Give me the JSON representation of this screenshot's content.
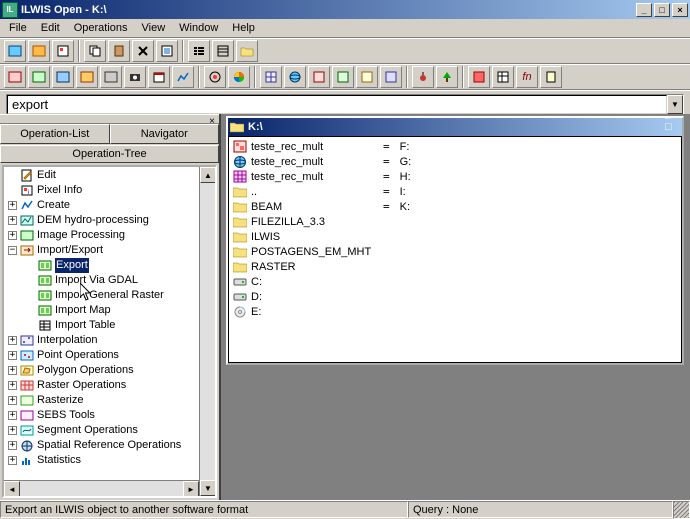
{
  "window": {
    "title": "ILWIS Open - K:\\"
  },
  "menu": [
    "File",
    "Edit",
    "Operations",
    "View",
    "Window",
    "Help"
  ],
  "command": {
    "value": "export"
  },
  "left_pane": {
    "tabs": [
      "Operation-List",
      "Navigator"
    ],
    "subtitle": "Operation-Tree",
    "tree": [
      {
        "lvl": 1,
        "exp": null,
        "icon": "edit-icon",
        "label": "Edit"
      },
      {
        "lvl": 1,
        "exp": null,
        "icon": "pixel-icon",
        "label": "Pixel Info"
      },
      {
        "lvl": 1,
        "exp": "+",
        "icon": "create-icon",
        "label": "Create"
      },
      {
        "lvl": 1,
        "exp": "+",
        "icon": "dem-icon",
        "label": "DEM hydro-processing"
      },
      {
        "lvl": 1,
        "exp": "+",
        "icon": "image-icon",
        "label": "Image Processing"
      },
      {
        "lvl": 1,
        "exp": "-",
        "icon": "importexport-icon",
        "label": "Import/Export"
      },
      {
        "lvl": 2,
        "exp": null,
        "icon": "op-icon",
        "label": "Export",
        "selected": true
      },
      {
        "lvl": 2,
        "exp": null,
        "icon": "op-icon",
        "label": "Import Via GDAL"
      },
      {
        "lvl": 2,
        "exp": null,
        "icon": "op-icon",
        "label": "Import General Raster"
      },
      {
        "lvl": 2,
        "exp": null,
        "icon": "op-icon",
        "label": "Import Map"
      },
      {
        "lvl": 2,
        "exp": null,
        "icon": "table-icon",
        "label": "Import Table"
      },
      {
        "lvl": 1,
        "exp": "+",
        "icon": "interp-icon",
        "label": "Interpolation"
      },
      {
        "lvl": 1,
        "exp": "+",
        "icon": "point-icon",
        "label": "Point Operations"
      },
      {
        "lvl": 1,
        "exp": "+",
        "icon": "poly-icon",
        "label": "Polygon Operations"
      },
      {
        "lvl": 1,
        "exp": "+",
        "icon": "raster-icon",
        "label": "Raster Operations"
      },
      {
        "lvl": 1,
        "exp": "+",
        "icon": "rasterize-icon",
        "label": "Rasterize"
      },
      {
        "lvl": 1,
        "exp": "+",
        "icon": "sebs-icon",
        "label": "SEBS Tools"
      },
      {
        "lvl": 1,
        "exp": "+",
        "icon": "segment-icon",
        "label": "Segment Operations"
      },
      {
        "lvl": 1,
        "exp": "+",
        "icon": "srs-icon",
        "label": "Spatial Reference Operations"
      },
      {
        "lvl": 1,
        "exp": "+",
        "icon": "stats-icon",
        "label": "Statistics"
      }
    ]
  },
  "child": {
    "title": "K:\\",
    "col1": [
      {
        "icon": "mpl-icon",
        "label": "teste_rec_mult"
      },
      {
        "icon": "globe-icon",
        "label": "teste_rec_mult"
      },
      {
        "icon": "raster-file-icon",
        "label": "teste_rec_mult"
      },
      {
        "icon": "folder-icon",
        "label": ".."
      },
      {
        "icon": "folder-icon",
        "label": "BEAM"
      },
      {
        "icon": "folder-icon",
        "label": "FILEZILLA_3.3"
      },
      {
        "icon": "folder-icon",
        "label": "ILWIS"
      },
      {
        "icon": "folder-icon",
        "label": "POSTAGENS_EM_MHT"
      },
      {
        "icon": "folder-icon",
        "label": "RASTER"
      },
      {
        "icon": "drive-icon",
        "label": "C:"
      },
      {
        "icon": "drive-icon",
        "label": "D:"
      },
      {
        "icon": "cd-icon",
        "label": "E:"
      }
    ],
    "col2": [
      {
        "attr": "=",
        "label": "F:"
      },
      {
        "attr": "=",
        "label": "G:"
      },
      {
        "attr": "=",
        "label": "H:"
      },
      {
        "attr": "=",
        "label": "I:"
      },
      {
        "attr": "=",
        "label": "K:"
      }
    ]
  },
  "status": {
    "hint": "Export an ILWIS object to another software format",
    "query": "Query : None"
  }
}
